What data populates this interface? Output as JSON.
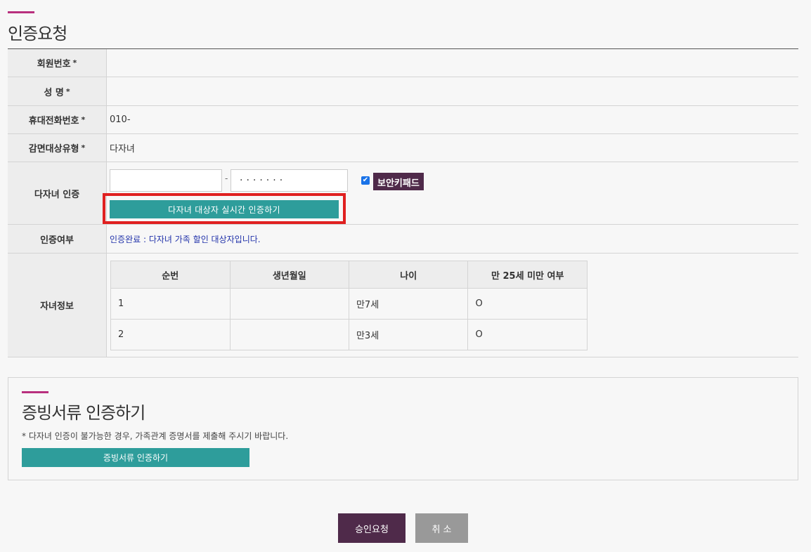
{
  "page": {
    "title": "인증요청"
  },
  "form": {
    "member_no": {
      "label": "회원번호",
      "value": ""
    },
    "name": {
      "label": "성 명",
      "value": ""
    },
    "phone": {
      "label": "휴대전화번호",
      "value": "010-"
    },
    "discount_type": {
      "label": "감면대상유형",
      "value": "다자녀"
    },
    "multichild_auth": {
      "label": "다자녀 인증",
      "rrn_front": "",
      "dash": "-",
      "rrn_back_masked": "·······",
      "secure_keypad_checked": true,
      "check_mark": "✔",
      "secure_keypad_label": "보안키패드",
      "auth_button": "다자녀 대상자 실시간 인증하기"
    },
    "auth_status": {
      "label": "인증여부",
      "value": "인증완료 : 다자녀 가족 할인 대상자입니다."
    },
    "children": {
      "label": "자녀정보",
      "columns": [
        "순번",
        "생년월일",
        "나이",
        "만 25세 미만 여부"
      ],
      "rows": [
        [
          "1",
          "",
          "만7세",
          "O"
        ],
        [
          "2",
          "",
          "만3세",
          "O"
        ]
      ]
    },
    "required_mark": "*"
  },
  "document_section": {
    "title": "증빙서류 인증하기",
    "note": "* 다자녀 인증이 불가능한 경우, 가족관계 증명서를 제출해 주시기 바랍니다.",
    "button": "증빙서류 인증하기"
  },
  "actions": {
    "approve": "승인요청",
    "cancel": "취 소"
  },
  "colors": {
    "accent": "#b8307e",
    "teal": "#2e9d9b",
    "plum": "#4f2a4a",
    "highlight": "#e02020"
  }
}
